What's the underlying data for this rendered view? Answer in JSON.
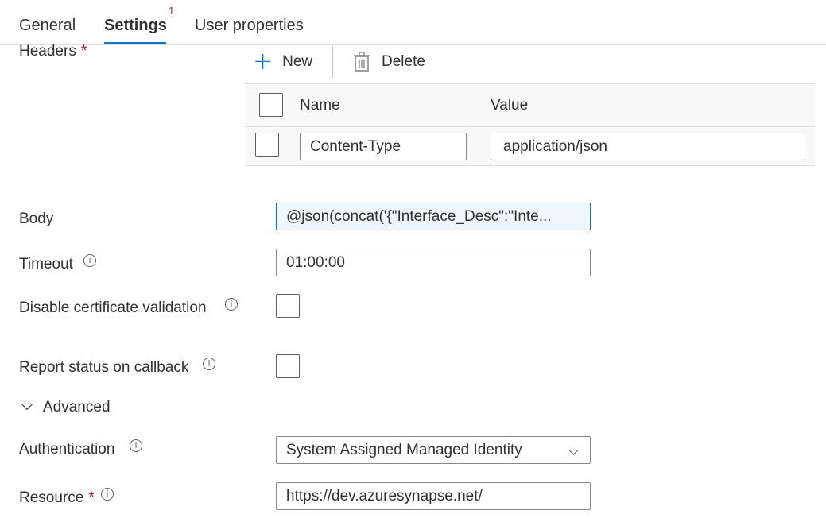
{
  "tabs": [
    {
      "label": "General"
    },
    {
      "label": "Settings",
      "badge": "1"
    },
    {
      "label": "User properties"
    }
  ],
  "headers": {
    "label": "Headers",
    "required_mark": "*",
    "toolbar": {
      "new_label": "New",
      "delete_label": "Delete"
    },
    "columns": {
      "name": "Name",
      "value": "Value"
    },
    "rows": [
      {
        "name": "Content-Type",
        "value": "application/json"
      }
    ]
  },
  "body": {
    "label": "Body",
    "value": "@json(concat('{\"Interface_Desc\":\"Inte..."
  },
  "timeout": {
    "label": "Timeout",
    "value": "01:00:00"
  },
  "disable_cert": {
    "label": "Disable certificate validation"
  },
  "report_status": {
    "label": "Report status on callback"
  },
  "advanced": {
    "label": "Advanced"
  },
  "authentication": {
    "label": "Authentication",
    "value": "System Assigned Managed Identity"
  },
  "resource": {
    "label": "Resource",
    "required_mark": "*",
    "value": "https://dev.azuresynapse.net/"
  },
  "icons": {
    "info": "info-icon",
    "add": "plus-icon",
    "delete": "trash-icon",
    "dropdown": "chevron-down-icon",
    "collapse": "chevron-down-icon"
  },
  "colors": {
    "accent": "#0078d4",
    "required": "#a4262c"
  }
}
